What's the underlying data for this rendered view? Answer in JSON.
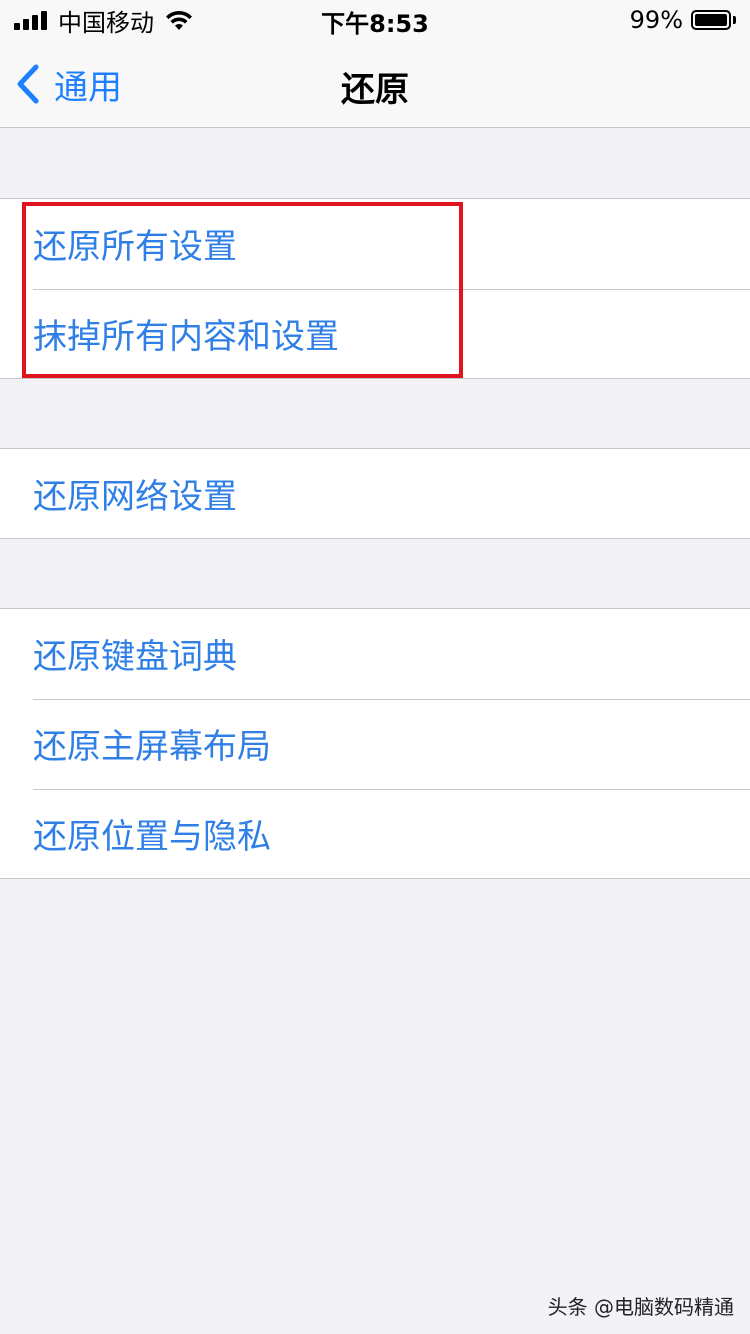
{
  "status_bar": {
    "carrier": "中国移动",
    "time": "下午8:53",
    "battery_percent": "99%",
    "battery_level": 0.99,
    "signal_bars": 4
  },
  "nav": {
    "back_label": "通用",
    "title": "还原",
    "back_icon": "chevron-left-icon"
  },
  "groups": [
    {
      "items": [
        {
          "label": "还原所有设置"
        },
        {
          "label": "抹掉所有内容和设置"
        }
      ]
    },
    {
      "items": [
        {
          "label": "还原网络设置"
        }
      ]
    },
    {
      "items": [
        {
          "label": "还原键盘词典"
        },
        {
          "label": "还原主屏幕布局"
        },
        {
          "label": "还原位置与隐私"
        }
      ]
    }
  ],
  "watermark": "头条 @电脑数码精通",
  "colors": {
    "accent": "#1e80ff",
    "item_text": "#2f7fe6",
    "highlight": "#e0141e",
    "background": "#f2f2f7"
  }
}
